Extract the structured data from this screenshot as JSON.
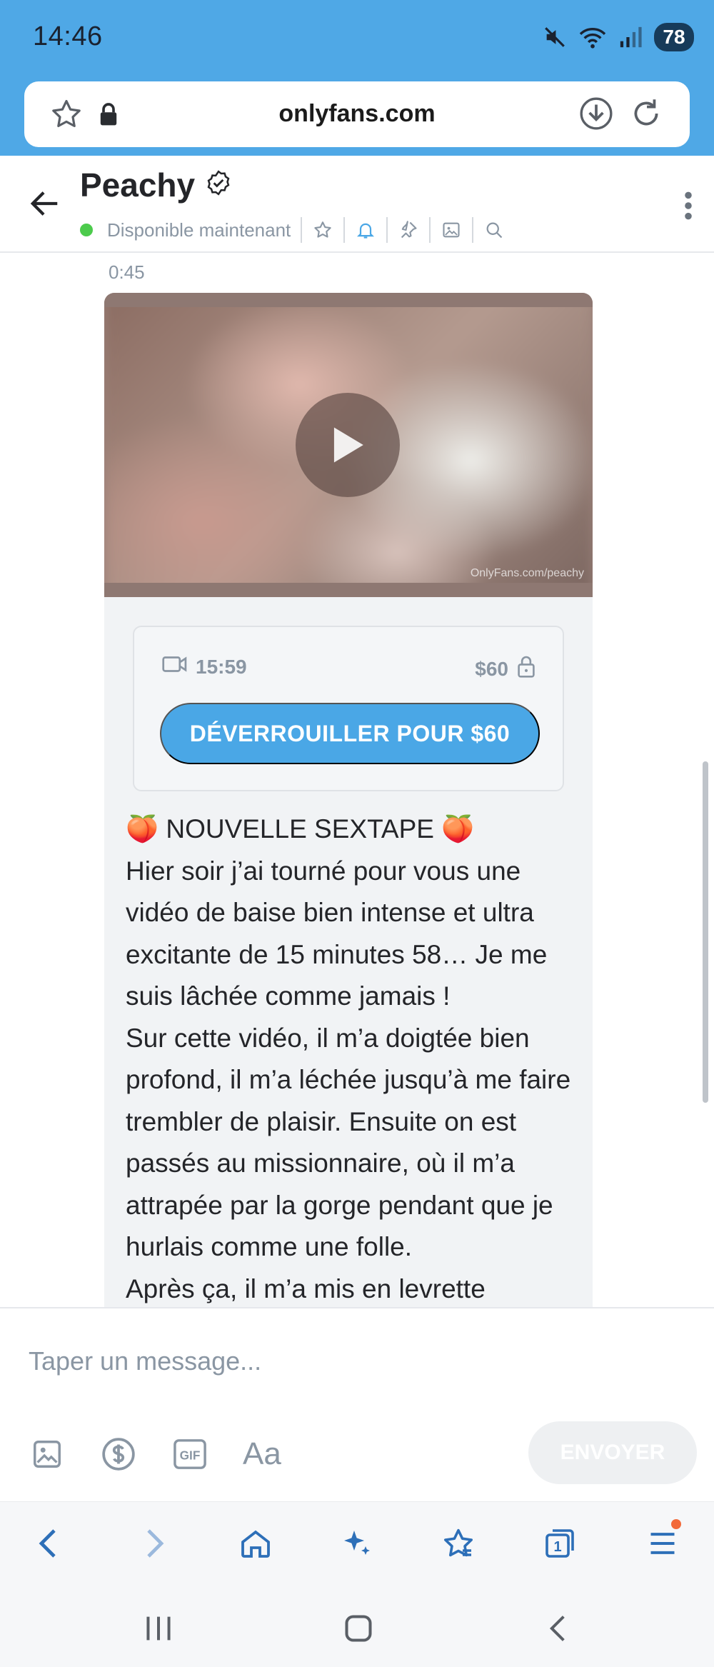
{
  "status_bar": {
    "time": "14:46",
    "battery": "78"
  },
  "browser": {
    "url": "onlyfans.com"
  },
  "chat_header": {
    "name": "Peachy",
    "presence": "Disponible maintenant"
  },
  "message": {
    "time": "0:45",
    "media_watermark": "OnlyFans.com/peachy",
    "duration": "15:59",
    "price": "$60",
    "unlock_label": "DÉVERROUILLER POUR $60",
    "text": "🍑 NOUVELLE SEXTAPE 🍑\nHier soir j’ai tourné pour vous une vidéo de baise bien intense et ultra excitante de 15 minutes 58… Je me suis lâchée comme jamais !\nSur cette vidéo, il m’a doigtée bien profond, il m’a léchée jusqu’à me faire trembler de plaisir. Ensuite on est passés au missionnaire, où il m’a attrapée par la gorge pendant que je hurlais comme une folle.\nAprès ça, il m’a mis en levrette"
  },
  "composer": {
    "placeholder": "Taper un message...",
    "format_label": "Aa",
    "send_label": "ENVOYER"
  },
  "browser_toolbar": {
    "tabs_count": "1"
  },
  "colors": {
    "accent": "#4aa7e6",
    "status_bar_bg": "#4fa8e6",
    "online": "#4ccb4c",
    "muted_text": "#8a96a3"
  },
  "icons": [
    "mute-icon",
    "wifi-icon",
    "signal-icon",
    "star-icon",
    "lock-icon",
    "download-icon",
    "reload-icon",
    "back-arrow-icon",
    "verified-icon",
    "bell-icon",
    "pin-icon",
    "image-icon",
    "search-icon",
    "kebab-icon",
    "play-icon",
    "video-icon",
    "dollar-icon",
    "gif-icon",
    "home-icon",
    "sparkle-icon",
    "bookmarks-icon",
    "tabs-icon",
    "menu-icon"
  ]
}
